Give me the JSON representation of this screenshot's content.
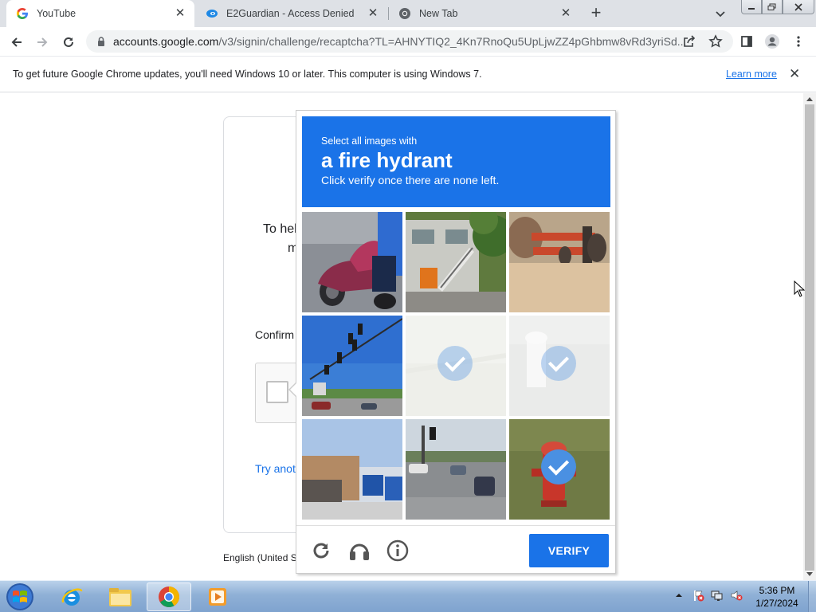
{
  "browser": {
    "tabs": [
      {
        "title": "YouTube",
        "icon": "google-g-icon",
        "active": true
      },
      {
        "title": "E2Guardian - Access Denied",
        "icon": "e2guardian-icon",
        "active": false
      },
      {
        "title": "New Tab",
        "icon": "chrome-icon",
        "active": false
      }
    ],
    "new_tab_symbol": "+",
    "tab_close_symbol": "✕",
    "url_host": "accounts.google.com",
    "url_path": "/v3/signin/challenge/recaptcha?TL=AHNYTIQ2_4Kn7RnoQu5UpLjwZZ4pGhbmw8vRd3yriSd...",
    "window_buttons": [
      "minimize",
      "restore",
      "close"
    ]
  },
  "infobar": {
    "message": "To get future Google Chrome updates, you'll need Windows 10 or later. This computer is using Windows 7.",
    "link": "Learn more",
    "close_symbol": "✕"
  },
  "page": {
    "help_line1": "To hel",
    "help_line2": "m",
    "confirm_label": "Confirm",
    "try_another": "Try anot",
    "language": "English (United S"
  },
  "recaptcha": {
    "instruction_line1": "Select all images with",
    "object": "a fire hydrant",
    "instruction_line3": "Click verify once there are none left.",
    "verify_label": "VERIFY",
    "accent_color": "#1a73e8",
    "check_color": "#4a90e2",
    "tiles": [
      {
        "subject": "motorcycle",
        "selected": false
      },
      {
        "subject": "building-stairs",
        "selected": false
      },
      {
        "subject": "machinery",
        "selected": false
      },
      {
        "subject": "traffic-lights",
        "selected": false
      },
      {
        "subject": "faded-pavement",
        "selected": true
      },
      {
        "subject": "faded-hydrant",
        "selected": true
      },
      {
        "subject": "street-bus",
        "selected": false
      },
      {
        "subject": "road-traffic",
        "selected": false
      },
      {
        "subject": "fire-hydrant",
        "selected": true
      }
    ],
    "footer_icons": [
      "reload-icon",
      "audio-icon",
      "info-icon"
    ]
  },
  "taskbar": {
    "pinned": [
      "internet-explorer-icon",
      "file-explorer-icon",
      "chrome-icon",
      "media-player-icon"
    ],
    "active": "chrome-icon",
    "tray_icons": [
      "show-hidden-icon",
      "action-center-icon",
      "network-icon",
      "volume-muted-icon"
    ],
    "time": "5:36 PM",
    "date": "1/27/2024"
  }
}
